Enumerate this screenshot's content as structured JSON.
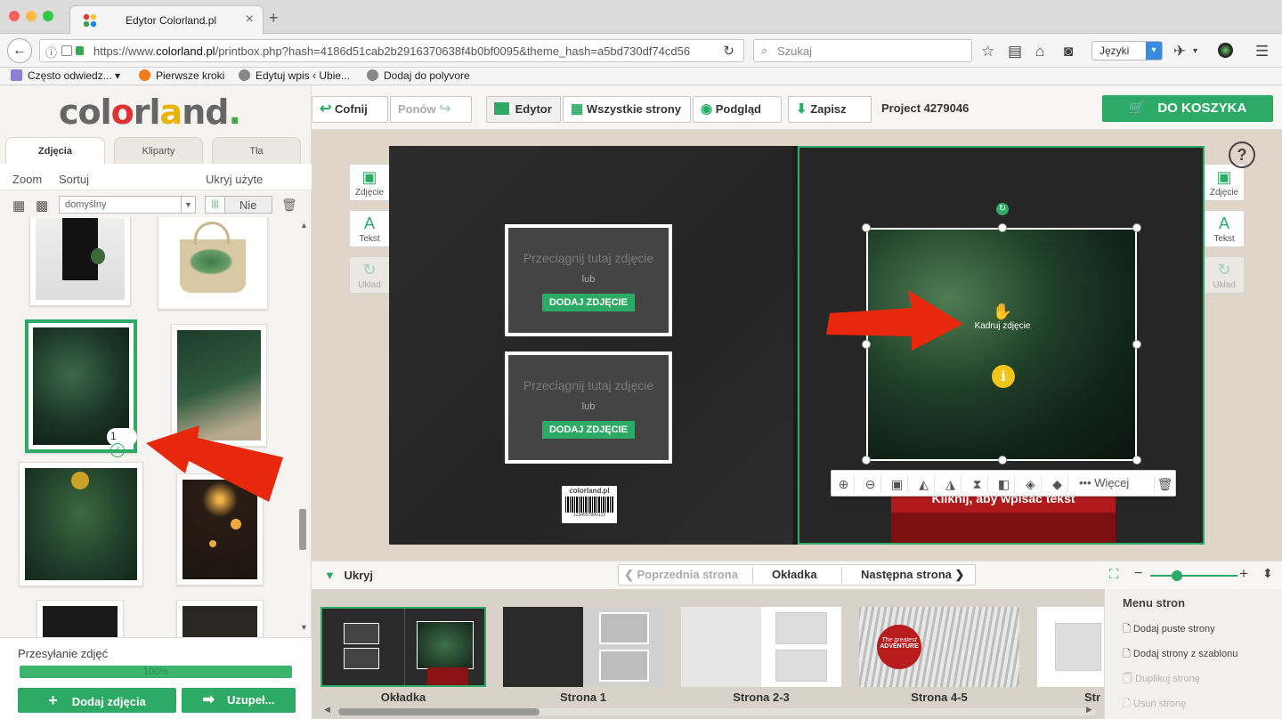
{
  "browser": {
    "tab_title": "Edytor Colorland.pl",
    "url_prefix": "https://www.",
    "url_domain": "colorland.pl",
    "url_rest": "/printbox.php?hash=4186d51cab2b2916370638f4b0bf0095&theme_hash=a5bd730df74cd56",
    "search_placeholder": "Szukaj",
    "language_select": "Języki",
    "bookmarks": [
      "Często odwiedz...",
      "Pierwsze kroki",
      "Edytuj wpis ‹ Ubie...",
      "Dodaj do polyvore"
    ]
  },
  "logo": {
    "part1": "col",
    "o1": "o",
    "part2": "rl",
    "o2": "a",
    "part3": "nd",
    "dot": "."
  },
  "left_panel": {
    "tabs": [
      "Zdjęcia",
      "Kliparty",
      "Tła"
    ],
    "zoom_label": "Zoom",
    "sort_label": "Sortuj",
    "hide_used_label": "Ukryj użyte",
    "sort_value": "domyślny",
    "hide_used_value": "Nie",
    "selected_count": "1",
    "upload_title": "Przesyłanie zdjęć",
    "upload_progress": "100%",
    "add_photos": "Dodaj zdjęcia",
    "autofill": "Uzupeł..."
  },
  "toolbar": {
    "undo": "Cofnij",
    "redo": "Ponów",
    "editor": "Edytor",
    "all_pages": "Wszystkie strony",
    "preview": "Podgląd",
    "save": "Zapisz",
    "project": "Project 4279046",
    "cart": "DO KOSZYKA"
  },
  "side_tools": {
    "photo": "Zdjęcie",
    "text": "Tekst",
    "layout": "Układ"
  },
  "canvas": {
    "drop_text": "Przeciągnij tutaj zdjęcie",
    "or_text": "lub",
    "add_photo": "DODAJ ZDJĘCIE",
    "crop_hint": "Kadruj zdjęcie",
    "text_placeholder": "Kliknij, aby wpisać tekst",
    "barcode_logo": "colorland.pl",
    "barcode_number": "1234567890123",
    "more": "Więcej",
    "info": "i"
  },
  "page_nav": {
    "hide": "Ukryj",
    "prev": "Poprzednia strona",
    "current": "Okładka",
    "next": "Następna strona"
  },
  "thumbnails": [
    "Okładka",
    "Strona 1",
    "Strona 2-3",
    "Strona 4-5",
    "Str"
  ],
  "thumb_badge": {
    "line1": "The greatest",
    "line2": "ADVENTURE"
  },
  "page_menu": {
    "title": "Menu stron",
    "items": [
      "Dodaj puste strony",
      "Dodaj strony z szablonu",
      "Duplikuj stronę",
      "Usuń stronę"
    ]
  },
  "colors": {
    "accent": "#2dab66",
    "arrow": "#e8280c"
  }
}
